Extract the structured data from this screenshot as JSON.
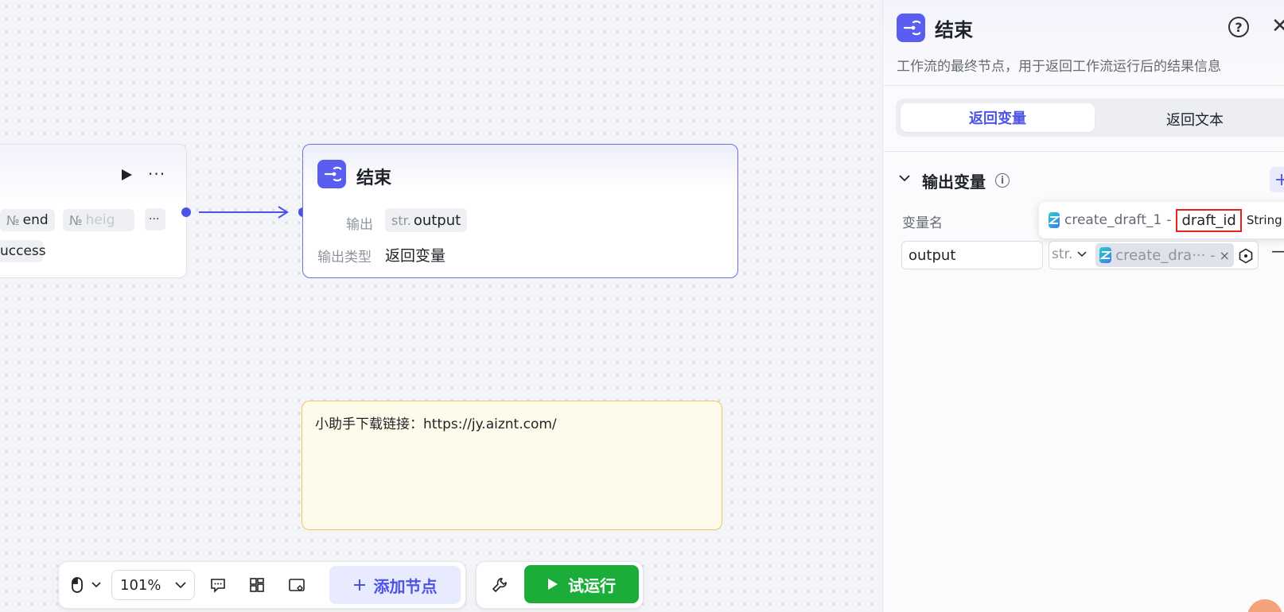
{
  "left_node": {
    "chip_end": {
      "prefix": "№",
      "label": "end"
    },
    "chip_height": {
      "prefix": "№",
      "label": "heig"
    },
    "chip_more": "···",
    "chip_success": "uccess"
  },
  "end_node": {
    "title": "结束",
    "output_label": "输出",
    "output_type_prefix": "str.",
    "output_value": "output",
    "output_type_label": "输出类型",
    "output_type_value": "返回变量"
  },
  "note": {
    "text": "小助手下载链接：https://jy.aiznt.com/"
  },
  "toolbar": {
    "zoom": "101%",
    "add_node": "添加节点",
    "run": "试运行"
  },
  "panel": {
    "title": "结束",
    "description": "工作流的最终节点，用于返回工作流运行后的结果信息",
    "tabs": [
      "返回变量",
      "返回文本"
    ],
    "section_title": "输出变量",
    "column_label": "变量名",
    "tooltip": {
      "node": "create_draft_1",
      "separator": "-",
      "field": "draft_id",
      "type": "String"
    },
    "row": {
      "name": "output",
      "type": "str.",
      "reference": "create_dra··· -"
    }
  },
  "colors": {
    "accent": "#4d53e8",
    "run_green": "#1aad3a",
    "highlight_red": "#e5231c",
    "note_border": "#f1c75a"
  }
}
